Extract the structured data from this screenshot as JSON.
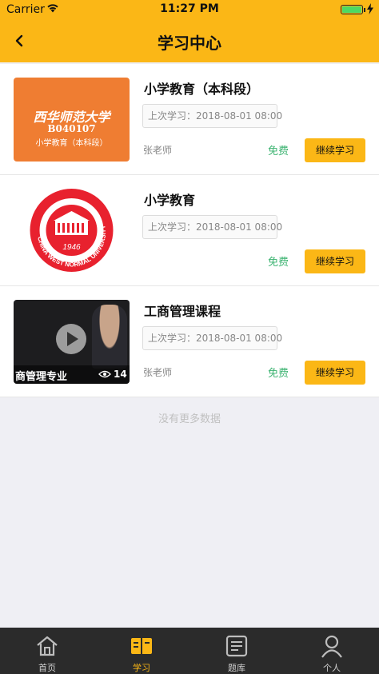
{
  "status_bar": {
    "carrier": "Carrier",
    "time": "11:27 PM"
  },
  "header": {
    "title": "学习中心"
  },
  "courses": [
    {
      "title": "小学教育（本科段）",
      "last_study": "上次学习：2018-08-01 08:00",
      "teacher": "张老师",
      "price": "免费",
      "button": "继续学习",
      "thumb": {
        "line1": "西华师范大学",
        "line2": "B040107",
        "line3": "小学教育（本科段）"
      }
    },
    {
      "title": "小学教育",
      "last_study": "上次学习：2018-08-01 08:00",
      "teacher": "",
      "price": "免费",
      "button": "继续学习",
      "thumb": {
        "ring_text": "CHINA WEST NORMAL UNIVERSITY",
        "year": "1946"
      }
    },
    {
      "title": "工商管理课程",
      "last_study": "上次学习：2018-08-01 08:00",
      "teacher": "张老师",
      "price": "免费",
      "button": "继续学习",
      "thumb": {
        "caption": "商管理专业",
        "views": "14"
      }
    }
  ],
  "footer_text": "没有更多数据",
  "tabs": [
    {
      "label": "首页",
      "icon": "home-icon",
      "active": false
    },
    {
      "label": "学习",
      "icon": "book-icon",
      "active": true
    },
    {
      "label": "题库",
      "icon": "question-bank-icon",
      "active": false
    },
    {
      "label": "个人",
      "icon": "person-icon",
      "active": false
    }
  ],
  "colors": {
    "accent": "#fbb716",
    "free": "#3cb371",
    "tabbar": "#2b2b2b",
    "thumb_orange": "#ef7d32",
    "logo_red": "#e8212e"
  }
}
